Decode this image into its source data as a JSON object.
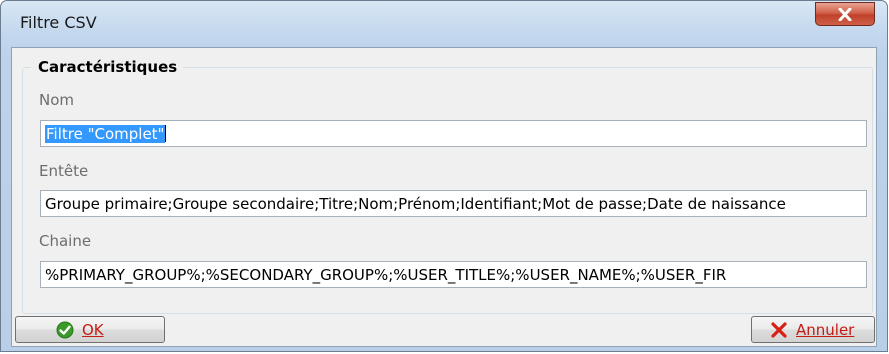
{
  "window": {
    "title": "Filtre CSV",
    "close_icon": "close-icon"
  },
  "group": {
    "title": "Caractéristiques"
  },
  "fields": {
    "name": {
      "label": "Nom",
      "value": "Filtre \"Complet\""
    },
    "header": {
      "label": "Entête",
      "value": "Groupe primaire;Groupe secondaire;Titre;Nom;Prénom;Identifiant;Mot de passe;Date de naissance"
    },
    "chain": {
      "label": "Chaine",
      "value": "%PRIMARY_GROUP%;%SECONDARY_GROUP%;%USER_TITLE%;%USER_NAME%;%USER_FIR"
    }
  },
  "buttons": {
    "ok": {
      "label": "OK",
      "icon": "check-icon",
      "icon_color": "#3a9a2a"
    },
    "cancel": {
      "label": "Annuler",
      "icon": "cross-icon",
      "icon_color": "#d81f16"
    }
  },
  "colors": {
    "selection": "#3399ff",
    "title_accent": "#cf6048"
  }
}
